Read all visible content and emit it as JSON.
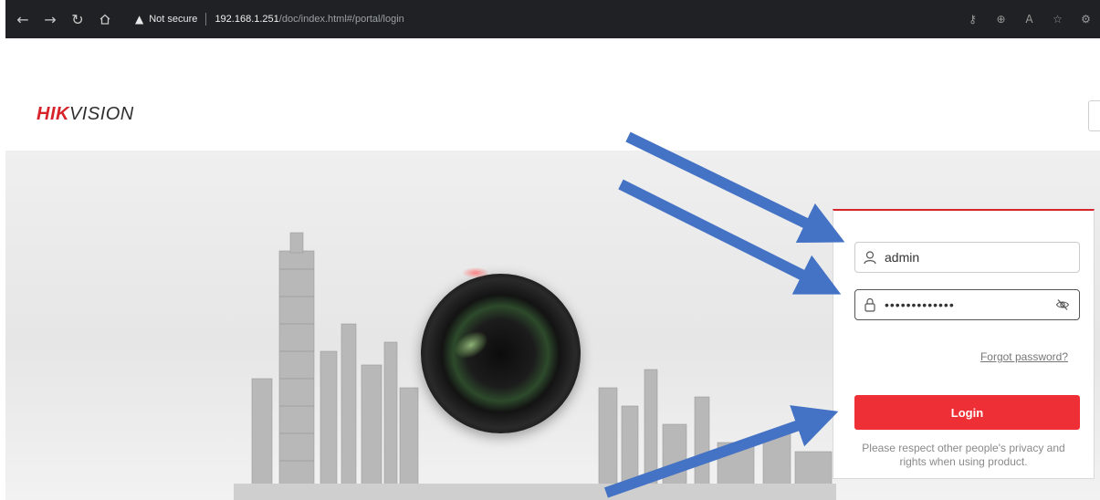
{
  "browser": {
    "warning_label": "Not secure",
    "url_host": "192.168.1.251",
    "url_path": "/doc/index.html#/portal/login",
    "icons": [
      "back-icon",
      "forward-icon",
      "refresh-icon",
      "home-icon",
      "warning-icon",
      "key-icon",
      "zoom-icon",
      "read-aloud-icon",
      "favorite-icon",
      "extensions-icon"
    ]
  },
  "brand": {
    "logo_red": "HIK",
    "logo_dark": "VISION",
    "red": "#d7242b"
  },
  "login": {
    "username_value": "admin",
    "password_mask": "•••••••••••••",
    "forgot_label": "Forgot password?",
    "login_label": "Login",
    "privacy_line1": "Please respect other people's privacy and",
    "privacy_line2": "rights when using product.",
    "button_color": "#ee2f35"
  },
  "annotations": {
    "arrow_color": "#4472c4",
    "arrow_count": 3
  }
}
